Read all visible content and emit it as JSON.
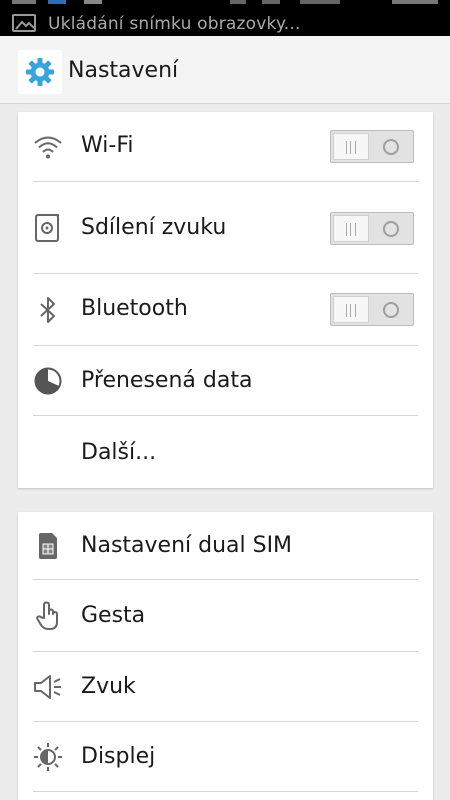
{
  "status_bar": {
    "notification_text": "Ukládání snímku obrazovky...",
    "notification_icon": "image-icon"
  },
  "action_bar": {
    "title": "Nastavení",
    "icon": "gear-icon",
    "icon_color": "#36a5dc"
  },
  "sections": [
    {
      "items": [
        {
          "label": "Wi-Fi",
          "icon": "wifi-icon",
          "toggle": "off"
        },
        {
          "label": "Sdílení zvuku",
          "icon": "audio-share-icon",
          "toggle": "off"
        },
        {
          "label": "Bluetooth",
          "icon": "bluetooth-icon",
          "toggle": "off"
        },
        {
          "label": "Přenesená data",
          "icon": "data-usage-icon"
        },
        {
          "label": "Další..."
        }
      ]
    },
    {
      "items": [
        {
          "label": "Nastavení dual SIM",
          "icon": "sim-card-icon"
        },
        {
          "label": "Gesta",
          "icon": "gesture-hand-icon"
        },
        {
          "label": "Zvuk",
          "icon": "speaker-icon"
        },
        {
          "label": "Displej",
          "icon": "brightness-icon"
        }
      ]
    }
  ]
}
